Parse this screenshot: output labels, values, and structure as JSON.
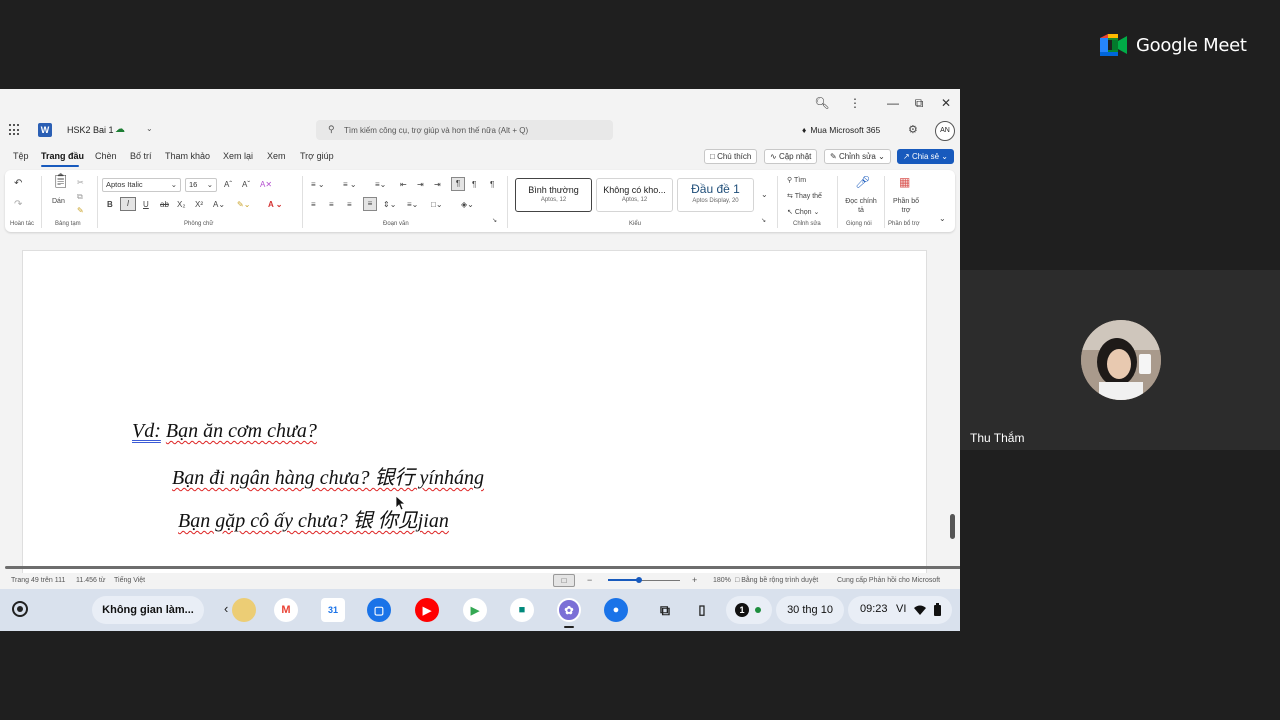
{
  "meet": {
    "brand": "Google Meet",
    "participant_name": "Thu Thắm"
  },
  "word": {
    "doc_title": "HSK2 Bai 1",
    "search_placeholder": "Tìm kiếm công cụ, trợ giúp và hơn thế nữa (Alt + Q)",
    "buy_label": "Mua Microsoft 365",
    "account_initials": "AN",
    "tabs": [
      "Tệp",
      "Trang đầu",
      "Chèn",
      "Bố trí",
      "Tham khảo",
      "Xem lại",
      "Xem",
      "Trợ giúp"
    ],
    "comments_label": "Chú thích",
    "catchup_label": "Cập nhật",
    "editing_label": "Chỉnh sửa",
    "share_label": "Chia sẻ",
    "ribbon": {
      "undo_label": "Hoàn tác",
      "paste_label": "Dán",
      "clipboard_label": "Bảng tạm",
      "font_name": "Aptos Italic",
      "font_size": "16",
      "font_group_label": "Phông chữ",
      "paragraph_label": "Đoạn văn",
      "styles_label": "Kiểu",
      "style_normal": "Bình thường",
      "style_normal_sub": "Aptos, 12",
      "style_nospacing": "Không có kho...",
      "style_nospacing_sub": "Aptos, 12",
      "style_heading1": "Đầu đề 1",
      "style_heading1_sub": "Aptos Display, 20",
      "find_label": "Tìm",
      "replace_label": "Thay thế",
      "select_label": "Chọn",
      "editing_group_label": "Chỉnh sửa",
      "dictate_label": "Đọc chính tả",
      "voice_label": "Giọng nói",
      "addins_label": "Phần bổ trợ",
      "addins_group_label": "Phần bổ trợ"
    },
    "document": {
      "line1_prefix": "Vd:",
      "line1_text": "Bạn ăn cơm chưa?",
      "line2_text": "Bạn đi ngân hàng chưa? 银行 yínháng",
      "line3_text": "Bạn gặp cô ấy chưa? 银 你见jian"
    },
    "status": {
      "page": "Trang 49 trên 111",
      "words": "11.456 từ",
      "language": "Tiếng Việt",
      "zoom": "180%",
      "fit_width": "Bằng bề rộng trình duyệt",
      "feedback": "Cung cấp Phản hồi cho Microsoft"
    }
  },
  "shelf": {
    "desk_label": "Không gian làm...",
    "notification_count": "1",
    "date": "30 thg 10",
    "time": "09:23",
    "locale": "VI"
  },
  "colors": {
    "word_blue": "#185abd",
    "meet_bg": "#1f1f1f",
    "shelf_bg": "#d9e1ed"
  }
}
